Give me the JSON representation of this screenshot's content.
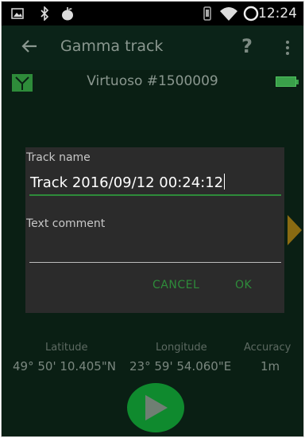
{
  "status_bar": {
    "time": "12:24",
    "icons": [
      "image-icon",
      "bluetooth-icon",
      "apple-icon",
      "vibrate-icon",
      "wifi-icon",
      "battery-ring-icon"
    ]
  },
  "app_bar": {
    "title": "Gamma track",
    "help_label": "?"
  },
  "device": {
    "name": "Virtuoso #1500009"
  },
  "dialog": {
    "track_name_label": "Track name",
    "track_name_value": "Track 2016/09/12 00:24:12",
    "text_comment_label": "Text comment",
    "text_comment_value": "",
    "cancel_label": "CANCEL",
    "ok_label": "OK"
  },
  "location": {
    "latitude_label": "Latitude",
    "longitude_label": "Longitude",
    "accuracy_label": "Accuracy",
    "latitude_value": "49° 50' 10.405\"N",
    "longitude_value": "23° 59' 54.060\"E",
    "accuracy_value": "1m"
  },
  "colors": {
    "background": "#0a1f14",
    "accent_green": "#2e8b3a",
    "dialog_bg": "#2b2b2b",
    "arrow_gold": "#8a6b12"
  }
}
